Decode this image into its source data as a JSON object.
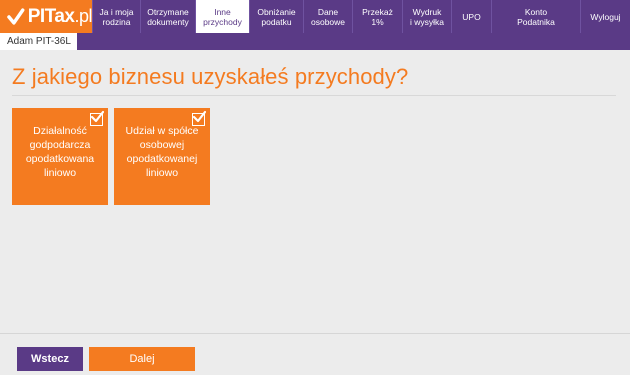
{
  "brand": {
    "logo_text": "PITax",
    "logo_suffix": ".pl"
  },
  "nav": [
    {
      "name": "nav-ja-i-moja-rodzina",
      "label": "Ja i moja\nrodzina",
      "width": 48,
      "active": false
    },
    {
      "name": "nav-otrzymane-dokumenty",
      "label": "Otrzymane\ndokumenty",
      "width": 55,
      "active": false
    },
    {
      "name": "nav-inne-przychody",
      "label": "Inne\nprzychody",
      "width": 54,
      "active": true
    },
    {
      "name": "nav-obnizanie-podatku",
      "label": "Obniżanie\npodatku",
      "width": 54,
      "active": false
    },
    {
      "name": "nav-dane-osobowe",
      "label": "Dane\nosobowe",
      "width": 49,
      "active": false
    },
    {
      "name": "nav-przekaz-1",
      "label": "Przekaż\n1%",
      "width": 50,
      "active": false
    },
    {
      "name": "nav-wydruk-i-wysylka",
      "label": "Wydruk\ni wysyłka",
      "width": 49,
      "active": false
    },
    {
      "name": "nav-upo",
      "label": "UPO",
      "width": 40,
      "active": false
    },
    {
      "name": "nav-konto-podatnika",
      "label": "Konto\nPodatnika",
      "width": 89,
      "active": false
    },
    {
      "name": "nav-wyloguj",
      "label": "Wyloguj",
      "width": 50,
      "active": false
    }
  ],
  "person_tab": "Adam PIT-36L",
  "heading": "Z jakiego biznesu uzyskałeś przychody?",
  "options": [
    {
      "label": "Działalność\ngodpodarcza\nopodatkowana\nliniowo",
      "checked": true
    },
    {
      "label": "Udział w spółce\nosobowej\nopodatkowanej\nliniowo",
      "checked": true
    }
  ],
  "buttons": {
    "back": "Wstecz",
    "next": "Dalej"
  },
  "colors": {
    "accent": "#f47b20",
    "brand": "#5a3a86"
  }
}
